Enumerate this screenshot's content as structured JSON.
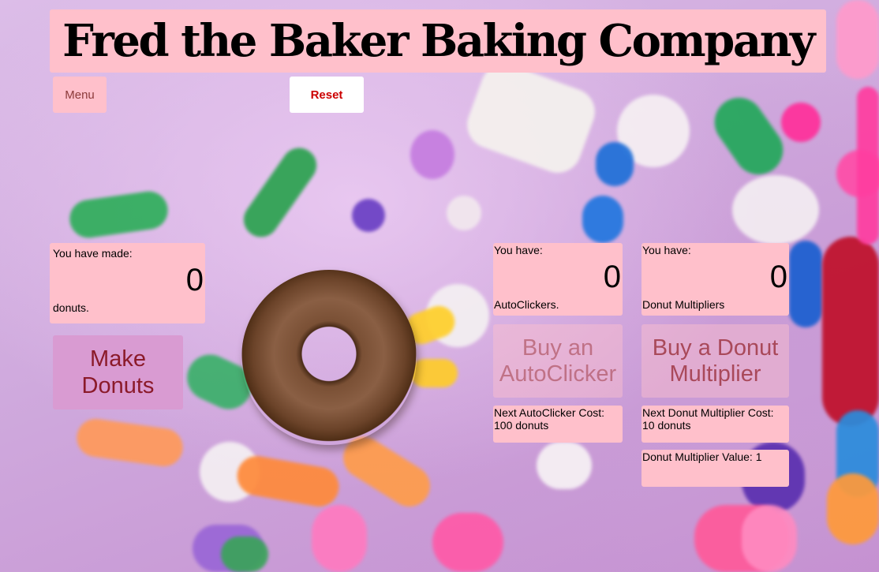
{
  "header": {
    "title": "Fred the Baker Baking Company"
  },
  "toolbar": {
    "menu_label": "Menu",
    "reset_label": "Reset"
  },
  "made": {
    "label_top": "You have made:",
    "count": "0",
    "label_bottom": "donuts."
  },
  "make_button": {
    "label": "Make Donuts"
  },
  "autoclickers": {
    "label_top": "You have:",
    "count": "0",
    "label_bottom": "AutoClickers.",
    "buy_label": "Buy an AutoClicker",
    "cost_label": "Next AutoClicker Cost:",
    "cost_value": "100 donuts"
  },
  "multipliers": {
    "label_top": "You have:",
    "count": "0",
    "label_bottom": "Donut Multipliers",
    "buy_label": "Buy a Donut Multiplier",
    "cost_label": "Next Donut Multiplier Cost:",
    "cost_value": "10 donuts",
    "value_label": "Donut Multiplier Value: 1"
  },
  "icons": {
    "donut": "donut-image"
  },
  "colors": {
    "panel_pink": "#ffc0cb",
    "make_button": "#d99bd2",
    "reset_text": "#cc0000"
  }
}
